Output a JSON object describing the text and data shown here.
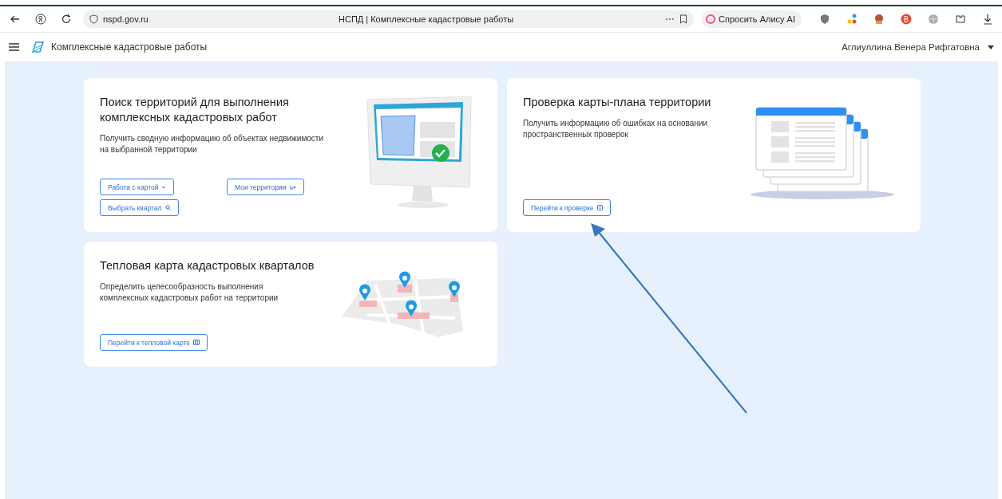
{
  "browser": {
    "address": "nspd.gov.ru",
    "tab_title": "НСПД | Комплексные кадастровые работы",
    "assistant_button": "Спросить Алису AI"
  },
  "header": {
    "app_title": "Комплексные кадастровые работы",
    "user_name": "Аглиуллина Венера Рифгатовна"
  },
  "cards": [
    {
      "kind": "monitor",
      "title": "Поиск территорий для выполнения комплексных кадастровых работ",
      "description": "Получить сводную информацию об объектах недвижимости на выбранной территории",
      "buttons": [
        {
          "label": "Работа с картой",
          "kind": "caret"
        },
        {
          "label": "Мои территории",
          "kind": "exit"
        },
        {
          "label": "Выбрать квартал",
          "kind": "search"
        }
      ]
    },
    {
      "kind": "windows",
      "title": "Проверка карты-плана территории",
      "description": "Получить информацию об ошибках на основании пространственных проверок",
      "buttons": [
        {
          "label": "Перейти к проверке",
          "kind": "external"
        }
      ]
    },
    {
      "kind": "map",
      "title": "Тепловая карта кадастровых кварталов",
      "description": "Определить целесообразность выполнения комплексных кадастровых работ на территории",
      "buttons": [
        {
          "label": "Перейти к тепловой карте",
          "kind": "map"
        }
      ]
    }
  ]
}
